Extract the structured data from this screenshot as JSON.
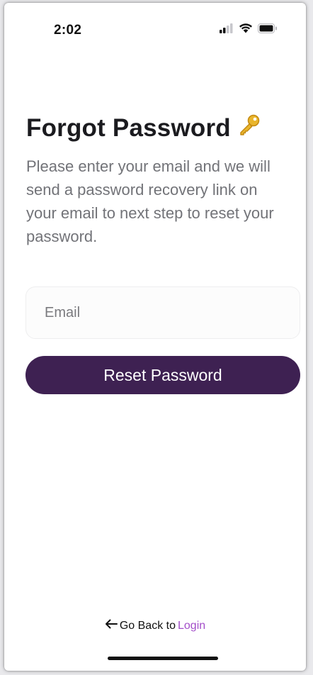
{
  "status_bar": {
    "time": "2:02",
    "icons": [
      "signal-icon",
      "wifi-icon",
      "battery-icon"
    ]
  },
  "page": {
    "title": "Forgot Password",
    "title_icon": "key-icon",
    "subtitle": "Please enter your email and we will send a password recovery link on your email to next step to reset your password."
  },
  "form": {
    "email_placeholder": "Email",
    "email_value": "",
    "submit_label": "Reset Password"
  },
  "footer": {
    "back_arrow_icon": "arrow-left-icon",
    "back_text": "Go Back to",
    "login_link": "Login"
  },
  "colors": {
    "primary_button": "#3e2152",
    "link": "#a34ec9",
    "subtitle_text": "#727378"
  }
}
